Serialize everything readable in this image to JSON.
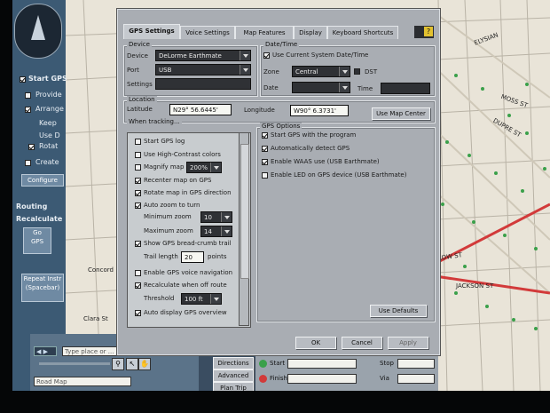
{
  "colors": {
    "dialog_bg": "#a9adb3",
    "map_bg": "#e9e4d8",
    "road_red": "#d23a3a",
    "tree_green": "#3aa04a",
    "panel_blue": "#3c5a74"
  },
  "left_panel": {
    "start_gps_label": "Start GPS",
    "options": [
      "Provide",
      "Arrange",
      "Keep",
      "Use D",
      "Rotat",
      "Create"
    ],
    "button_label": "Configure",
    "routing_label": "Routing",
    "recalculate_label": "Recalculate",
    "gps_button": "Go\nGPS",
    "repeat_label": "Repeat Instr\n(Spacebar)"
  },
  "dialog": {
    "tabs": [
      "GPS Settings",
      "Voice Settings",
      "Map Features",
      "Display",
      "Keyboard Shortcuts"
    ],
    "help_label": "?",
    "device": {
      "title": "Device",
      "device_label": "Device",
      "device_value": "DeLorme Earthmate",
      "port_label": "Port",
      "port_value": "USB",
      "settings_label": "Settings"
    },
    "datetime": {
      "title": "Date/Time",
      "use_system_label": "Use Current System Date/Time",
      "zone_label": "Zone",
      "zone_value": "Central",
      "dst_label": "DST",
      "date_label": "Date",
      "time_label": "Time"
    },
    "location": {
      "title": "Location",
      "latitude_label": "Latitude",
      "latitude_value": "N29° 56.6445'",
      "longitude_label": "Longitude",
      "longitude_value": "W90° 6.3731'",
      "use_map_center_label": "Use Map Center"
    },
    "tracking": {
      "title": "When tracking...",
      "items": [
        {
          "label": "Start GPS log",
          "checked": false
        },
        {
          "label": "Use High-Contrast colors",
          "checked": false
        },
        {
          "label": "Magnify map",
          "checked": false,
          "value": "200%"
        },
        {
          "label": "Recenter map on GPS",
          "checked": true
        },
        {
          "label": "Rotate map in GPS direction",
          "checked": true
        },
        {
          "label": "Auto zoom to turn",
          "checked": true
        },
        {
          "label": "Minimum zoom",
          "value": "10"
        },
        {
          "label": "Maximum zoom",
          "value": "14"
        },
        {
          "label": "Show GPS bread-crumb trail",
          "checked": true
        },
        {
          "label": "Trail length",
          "value": "20",
          "unit": "points"
        },
        {
          "label": "Enable GPS voice navigation",
          "checked": false
        },
        {
          "label": "Recalculate when off route",
          "checked": true
        },
        {
          "label": "Threshold",
          "value": "100 ft"
        },
        {
          "label": "Auto display GPS overview",
          "checked": true
        }
      ]
    },
    "gps_options": {
      "title": "GPS Options",
      "items": [
        {
          "label": "Start GPS with the program",
          "checked": true
        },
        {
          "label": "Automatically detect GPS",
          "checked": true
        },
        {
          "label": "Enable WAAS use (USB Earthmate)",
          "checked": true
        },
        {
          "label": "Enable LED on GPS device (USB Earthmate)",
          "checked": false
        }
      ]
    },
    "use_defaults_label": "Use Defaults",
    "ok_label": "OK",
    "cancel_label": "Cancel",
    "apply_label": "Apply"
  },
  "bottom_bar": {
    "search_placeholder": "Type place or ...",
    "map_type": "Road Map",
    "directions_label": "Directions",
    "advanced_label": "Advanced",
    "plan_trip_label": "Plan Trip",
    "start_label": "Start",
    "finish_label": "Finish",
    "stop_label": "Stop",
    "via_label": "Via"
  },
  "map_labels": {
    "street1": "LOW ST",
    "street2": "JACKSON ST",
    "street3": "DUPRE ST",
    "street4": "ELYSIAN",
    "street5": "MOSS ST",
    "left_street": "Concord",
    "left_street2": "Clara St"
  }
}
